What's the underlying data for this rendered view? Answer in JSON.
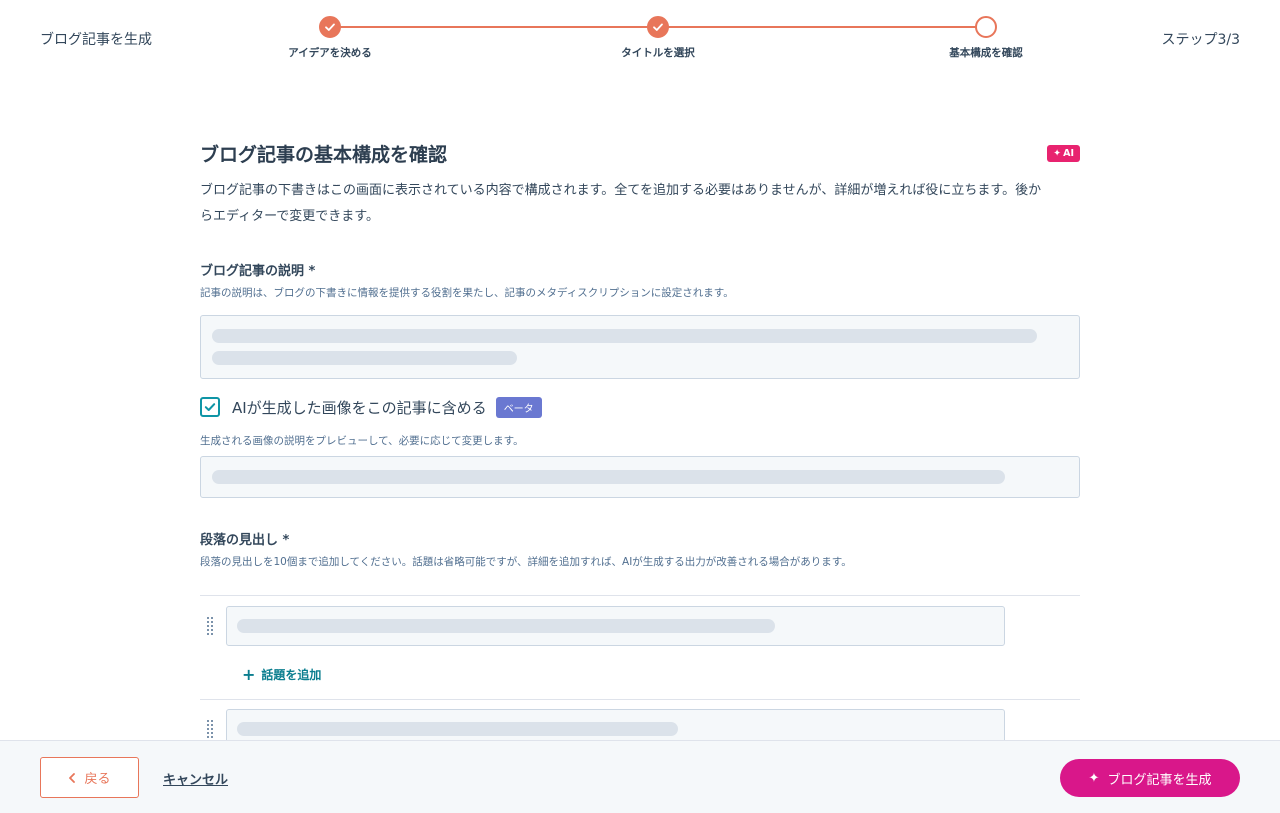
{
  "header": {
    "title": "ブログ記事を生成",
    "step_count": "ステップ3/3",
    "steps": [
      {
        "label": "アイデアを決める",
        "status": "completed"
      },
      {
        "label": "タイトルを選択",
        "status": "completed"
      },
      {
        "label": "基本構成を確認",
        "status": "current"
      }
    ]
  },
  "main": {
    "title": "ブログ記事の基本構成を確認",
    "ai_badge": "AI",
    "description": "ブログ記事の下書きはこの画面に表示されている内容で構成されます。全てを追加する必要はありませんが、詳細が増えれば役に立ちます。後からエディターで変更できます。",
    "blog_description": {
      "label": "ブログ記事の説明 *",
      "help": "記事の説明は、ブログの下書きに情報を提供する役割を果たし、記事のメタディスクリプションに設定されます。"
    },
    "ai_image": {
      "checked": true,
      "label": "AIが生成した画像をこの記事に含める",
      "beta": "ベータ",
      "help": "生成される画像の説明をプレビューして、必要に応じて変更します。"
    },
    "paragraph_headings": {
      "label": "段落の見出し *",
      "help": "段落の見出しを10個まで追加してください。話題は省略可能ですが、詳細を追加すれば、AIが生成する出力が改善される場合があります。",
      "add_topic": "話題を追加"
    }
  },
  "footer": {
    "back": "戻る",
    "cancel": "キャンセル",
    "generate": "ブログ記事を生成"
  },
  "colors": {
    "accent": "#e8765a",
    "teal": "#0f95a6",
    "magenta": "#d9178a",
    "ai_pink": "#e8236f",
    "beta": "#6a78d1"
  }
}
